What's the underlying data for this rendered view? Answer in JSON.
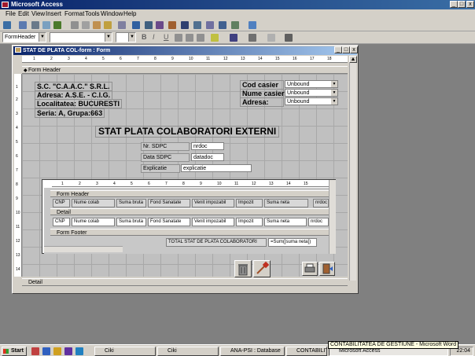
{
  "app": {
    "title": "Microsoft Access",
    "controls": {
      "minimize": "_",
      "maximize": "□",
      "close": "x"
    }
  },
  "menu": [
    "File",
    "Edit",
    "View",
    "Insert",
    "Format",
    "Tools",
    "Window",
    "Help"
  ],
  "formatting": {
    "object_combo": "FormHeader",
    "bold": "B",
    "italic": "I",
    "underline": "U"
  },
  "form_window": {
    "title": "STAT DE PLATA COL-form : Form",
    "controls": {
      "minimize": "_",
      "maximize": "□",
      "close": "x"
    },
    "ruler_marks": [
      "1",
      "2",
      "3",
      "4",
      "5",
      "6",
      "7",
      "8",
      "9",
      "10",
      "11",
      "12",
      "13",
      "14",
      "15",
      "16",
      "17",
      "18"
    ],
    "vruler_marks": [
      "1",
      "2",
      "3",
      "4",
      "5",
      "6",
      "7",
      "8",
      "9",
      "10",
      "11",
      "12",
      "13",
      "14"
    ],
    "form_header_label": "Form Header",
    "detail_label": "Detail",
    "company": {
      "name": "S.C. \"C.A.A.C.\" S.R.L.",
      "address": "Adresa: A.S.E. - C.I.G.",
      "locality": "Localitatea: BUCURESTI",
      "series": "Seria: A, Grupa:663"
    },
    "cashier": {
      "code_label": "Cod casier",
      "name_label": "Nume casier",
      "address_label": "Adresa:",
      "code_value": "Unbound",
      "name_value": "Unbound",
      "address_value": "Unbound"
    },
    "heading": "STAT PLATA COLABORATORI EXTERNI",
    "doc": {
      "nr_label": "Nr. SDPC",
      "nr_value": "nrdoc",
      "date_label": "Data SDPC",
      "date_value": "datadoc",
      "expl_label": "Explicatie",
      "expl_value": "explicatie"
    }
  },
  "subform": {
    "ruler_marks": [
      "1",
      "2",
      "3",
      "4",
      "5",
      "6",
      "7",
      "8",
      "9",
      "10",
      "11",
      "12",
      "13",
      "14",
      "15"
    ],
    "form_header_label": "Form Header",
    "detail_label": "Detail",
    "form_footer_label": "Form Footer",
    "header_cols": [
      "CNP",
      "Nume colab",
      "Suma bruta",
      "Fond Sanatate",
      "Venit impozabil",
      "Impozit",
      "Suma neta",
      "nrdoc"
    ],
    "detail_cols": [
      "CNP",
      "Nume colab",
      "Suma bruta",
      "Fond Sanatate",
      "Venit impozabil",
      "Impozit",
      "Suma neta",
      "nrdoc"
    ],
    "footer_label": "TOTAL STAT DE PLATA COLABORATORI",
    "footer_value": "=Sum([suma neta])"
  },
  "taskbar": {
    "start": "Start",
    "tasks": [
      "Ciki",
      "Ciki",
      "ANA-PSI : Database",
      "CONTABILITATEA D...",
      "Microsoft Access"
    ],
    "tooltip": "CONTABILITATEA DE GESTIUNE - Microsoft Word",
    "clock": "22:04"
  },
  "colors": {
    "titlebar": "#0a246a",
    "face": "#d4d0c8",
    "grid": "#c0c0c0"
  }
}
